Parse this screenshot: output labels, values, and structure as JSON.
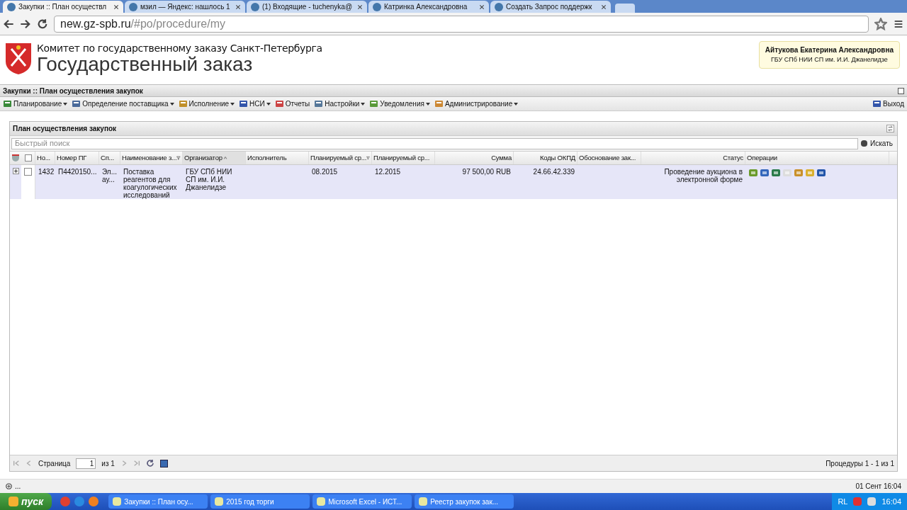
{
  "browser": {
    "tabs": [
      {
        "title": "Закупки :: План осуществл",
        "selected": true
      },
      {
        "title": "мзил — Яндекс: нашлось 1",
        "selected": false
      },
      {
        "title": "(1) Входящие - tuchenyka@",
        "selected": false
      },
      {
        "title": "Катринка Александровна",
        "selected": false
      },
      {
        "title": "Создать Запрос поддержк",
        "selected": false
      }
    ],
    "url_host": "new.gz-spb.ru",
    "url_path": "/#po/procedure/my"
  },
  "header": {
    "subtitle": "Комитет по государственному заказу Санкт-Петербурга",
    "title": "Государственный заказ",
    "user_name": "Айтукова Екатерина Александровна",
    "user_org": "ГБУ СПб НИИ СП им. И.И. Джанелидзе"
  },
  "app_title": "Закупки :: План осуществления закупок",
  "menu": [
    {
      "label": "Планирование",
      "dropdown": true
    },
    {
      "label": "Определение поставщика",
      "dropdown": true
    },
    {
      "label": "Исполнение",
      "dropdown": true
    },
    {
      "label": "НСИ",
      "dropdown": true
    },
    {
      "label": "Отчеты",
      "dropdown": false
    },
    {
      "label": "Настройки",
      "dropdown": true
    },
    {
      "label": "Уведомления",
      "dropdown": true
    },
    {
      "label": "Администрирование",
      "dropdown": true
    }
  ],
  "logout": "Выход",
  "panel": {
    "title": "План осуществления закупок",
    "search_placeholder": "Быстрый поиск",
    "search_button": "Искать",
    "all_checked": false,
    "columns": [
      {
        "label": "Но...",
        "filtered": false,
        "sorted": false
      },
      {
        "label": "Номер ПГ",
        "filtered": false,
        "sorted": false
      },
      {
        "label": "Сп...",
        "filtered": false,
        "sorted": false
      },
      {
        "label": "Наименование з...",
        "filtered": true,
        "sorted": false
      },
      {
        "label": "Организатор",
        "filtered": false,
        "sorted": true
      },
      {
        "label": "Исполнитель",
        "filtered": false,
        "sorted": false
      },
      {
        "label": "Планируемый ср...",
        "filtered": true,
        "sorted": false
      },
      {
        "label": "Планируемый ср...",
        "filtered": false,
        "sorted": false
      },
      {
        "label": "Сумма",
        "filtered": false,
        "sorted": false
      },
      {
        "label": "Коды ОКПД",
        "filtered": false,
        "sorted": false
      },
      {
        "label": "Обоснование зак...",
        "filtered": false,
        "sorted": false
      },
      {
        "label": "Статус",
        "filtered": false,
        "sorted": false
      },
      {
        "label": "Операции",
        "filtered": false,
        "sorted": false
      }
    ],
    "rows": [
      {
        "checked": false,
        "cells": [
          "1432",
          "П4420150...",
          "Эл... ау...",
          "Поставка реагентов для коагулогических исследований",
          "ГБУ СПб НИИ СП им. И.И. Джанелидзе",
          "",
          "08.2015",
          "12.2015",
          "97 500,00 RUB",
          "24.66.42.339",
          "",
          "Проведение аукциона в электронной форме"
        ]
      }
    ],
    "paging": {
      "page_label": "Страница",
      "page": "1",
      "of": "из 1",
      "summary": "Процедуры 1 - 1 из 1"
    }
  },
  "status_bar": {
    "left": "...",
    "right": "01 Сент 16:04"
  },
  "taskbar": {
    "start": "пуск",
    "items": [
      "Закупки :: План осу...",
      "2015 год торги",
      "Microsoft Excel - ИСТ...",
      "Реестр закупок зак..."
    ],
    "lang": "RL",
    "clock": "16:04"
  }
}
